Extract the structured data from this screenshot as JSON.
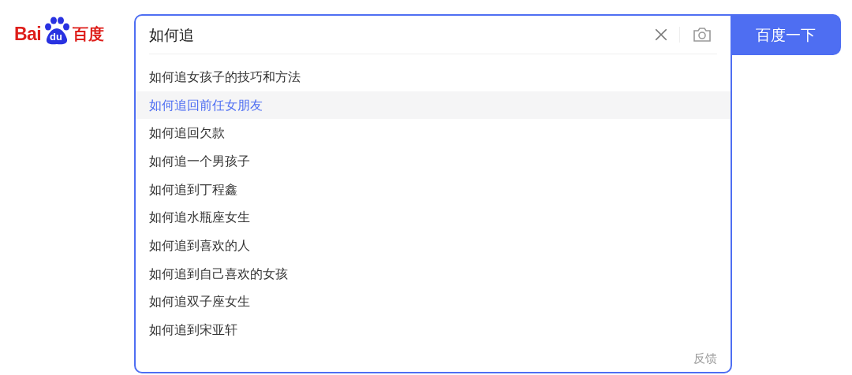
{
  "logo": {
    "latin": "Bai",
    "paw_text": "du",
    "chinese": "百度"
  },
  "search": {
    "value": "如何追"
  },
  "submit_button": "百度一下",
  "suggestions": [
    {
      "text": "如何追女孩子的技巧和方法",
      "selected": false
    },
    {
      "text": "如何追回前任女朋友",
      "selected": true
    },
    {
      "text": "如何追回欠款",
      "selected": false
    },
    {
      "text": "如何追一个男孩子",
      "selected": false
    },
    {
      "text": "如何追到丁程鑫",
      "selected": false
    },
    {
      "text": "如何追水瓶座女生",
      "selected": false
    },
    {
      "text": "如何追到喜欢的人",
      "selected": false
    },
    {
      "text": "如何追到自己喜欢的女孩",
      "selected": false
    },
    {
      "text": "如何追双子座女生",
      "selected": false
    },
    {
      "text": "如何追到宋亚轩",
      "selected": false
    }
  ],
  "feedback_link": "反馈"
}
